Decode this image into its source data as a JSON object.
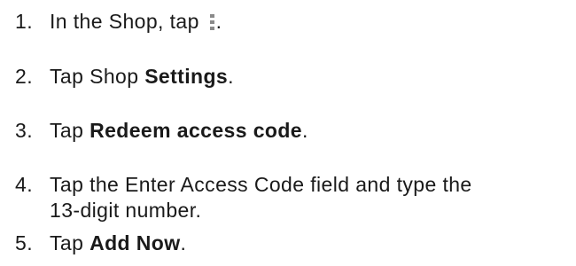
{
  "steps": [
    {
      "number": "1.",
      "before": "In the Shop, tap ",
      "icon": "more-options-icon",
      "after": "."
    },
    {
      "number": "2.",
      "before": "Tap Shop ",
      "bold": "Settings",
      "after": "."
    },
    {
      "number": "3.",
      "before": "Tap ",
      "bold": "Redeem access code",
      "after": "."
    },
    {
      "number": "4.",
      "line1": "Tap the Enter Access Code field and type the",
      "line2": "13-digit number."
    },
    {
      "number": "5.",
      "before": "Tap ",
      "bold": "Add Now",
      "after": "."
    }
  ]
}
